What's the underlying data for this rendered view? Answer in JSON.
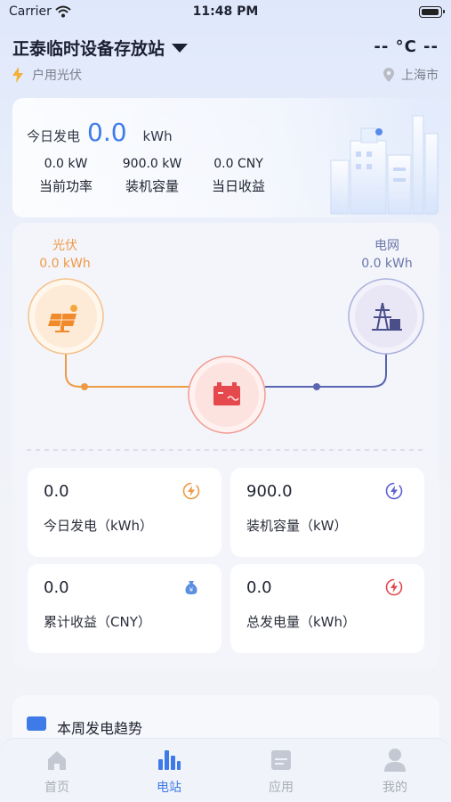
{
  "status_bar": {
    "carrier": "Carrier",
    "time": "11:48 PM"
  },
  "header": {
    "station_name": "正泰临时设备存放站",
    "weather": "-- °C  --",
    "type_label": "户用光伏",
    "location": "上海市"
  },
  "summary": {
    "today_label": "今日发电",
    "today_value": "0.0",
    "today_unit": "kWh",
    "metrics": [
      {
        "value": "0.0 kW",
        "label": "当前功率"
      },
      {
        "value": "900.0 kW",
        "label": "装机容量"
      },
      {
        "value": "0.0 CNY",
        "label": "当日收益"
      }
    ]
  },
  "flow": {
    "pv_name": "光伏",
    "pv_value": "0.0 kWh",
    "grid_name": "电网",
    "grid_value": "0.0 kWh",
    "colors": {
      "pv": "#ef9a45",
      "grid": "#5a64b0",
      "battery": "#e5484d"
    }
  },
  "stats": [
    {
      "value": "0.0",
      "label": "今日发电（kWh）",
      "icon": "orange-bolt-icon",
      "color": "#ef9a45"
    },
    {
      "value": "900.0",
      "label": "装机容量（kW）",
      "icon": "purple-bolt-icon",
      "color": "#5b5fd6"
    },
    {
      "value": "0.0",
      "label": "累计收益（CNY）",
      "icon": "money-bag-icon",
      "color": "#5b8fe0"
    },
    {
      "value": "0.0",
      "label": "总发电量（kWh）",
      "icon": "red-bolt-icon",
      "color": "#e5484d"
    }
  ],
  "trend": {
    "title": "本周发电趋势"
  },
  "tabs": [
    {
      "label": "首页",
      "icon": "home-icon",
      "active": false
    },
    {
      "label": "电站",
      "icon": "bar-chart-icon",
      "active": true
    },
    {
      "label": "应用",
      "icon": "apps-icon",
      "active": false
    },
    {
      "label": "我的",
      "icon": "user-icon",
      "active": false
    }
  ],
  "accent_color": "#3f7be8"
}
